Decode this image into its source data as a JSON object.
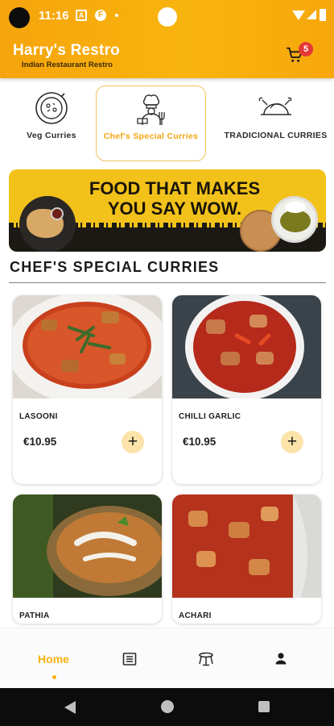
{
  "status_bar": {
    "time": "11:16",
    "icons": [
      "camera-hole",
      "notification-a-icon",
      "notification-f-icon",
      "dot-icon",
      "front-camera",
      "wifi-icon",
      "signal-icon",
      "battery-icon"
    ]
  },
  "app_bar": {
    "title": "Harry's Restro",
    "subtitle": "Indian Restaurant Restro",
    "cart_count": "5",
    "colors": {
      "gradient_start": "#f6a40c",
      "gradient_end": "#f8b40e",
      "badge": "#e53935"
    }
  },
  "categories": [
    {
      "label": "Veg Curries",
      "icon": "veg-curry-icon",
      "active": false
    },
    {
      "label": "Chef's Special Curries",
      "icon": "chef-icon",
      "active": true
    },
    {
      "label": "TRADICIONAL CURRIES",
      "icon": "roast-chicken-icon",
      "active": false
    }
  ],
  "banner": {
    "line1": "FOOD THAT MAKES",
    "line2": "YOU SAY WOW."
  },
  "section": {
    "title": "CHEF'S SPECIAL CURRIES"
  },
  "items": [
    {
      "name": "LASOONI",
      "price": "€10.95",
      "add_label": "+"
    },
    {
      "name": "CHILLI GARLIC",
      "price": "€10.95",
      "add_label": "+"
    },
    {
      "name": "PATHIA",
      "price": "",
      "add_label": ""
    },
    {
      "name": "ACHARI",
      "price": "",
      "add_label": ""
    }
  ],
  "bottom_nav": {
    "items": [
      {
        "label": "Home",
        "icon": "home-icon",
        "active": true
      },
      {
        "label": "",
        "icon": "menu-list-icon",
        "active": false
      },
      {
        "label": "",
        "icon": "dining-table-icon",
        "active": false
      },
      {
        "label": "",
        "icon": "profile-icon",
        "active": false
      }
    ],
    "accent": "#f5b20f"
  },
  "system_nav": {
    "icons": [
      "back-icon",
      "home-circle-icon",
      "recents-icon"
    ]
  }
}
